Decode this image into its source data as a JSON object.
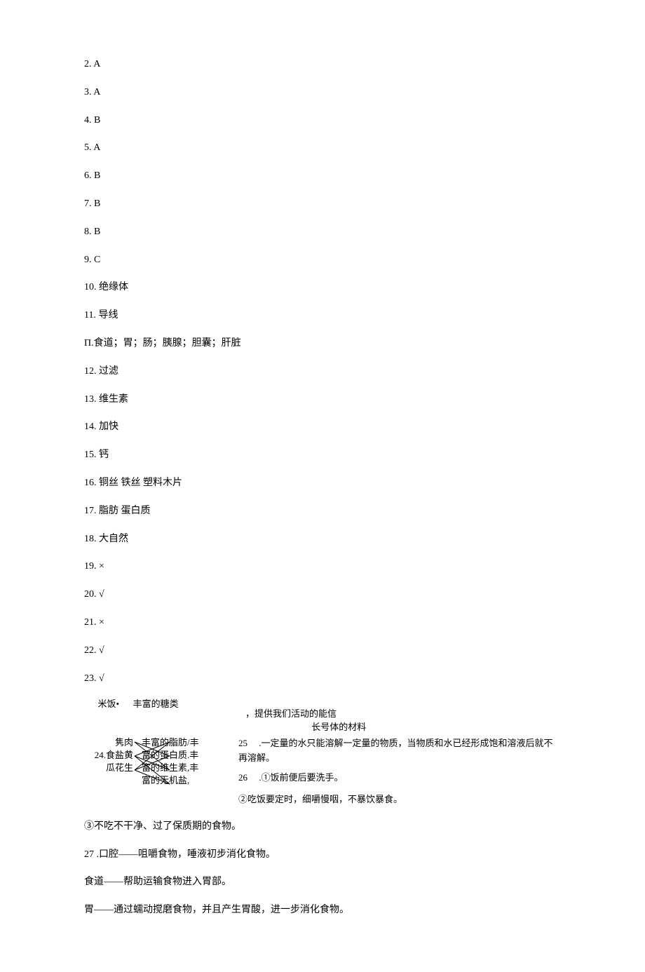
{
  "answers": [
    {
      "num": "2.",
      "val": "A"
    },
    {
      "num": "3.",
      "val": "A"
    },
    {
      "num": "4.",
      "val": "B"
    },
    {
      "num": "5.",
      "val": "A"
    },
    {
      "num": "6.",
      "val": "B"
    },
    {
      "num": "7.",
      "val": "B"
    },
    {
      "num": "8.",
      "val": "B"
    },
    {
      "num": "9.",
      "val": "C"
    },
    {
      "num": "10.",
      "val": "绝缘体"
    },
    {
      "num": "11.",
      "val": " 导线"
    }
  ],
  "rowPi": "Π.食道；胃；肠；胰腺；胆囊；肝脏",
  "answers2": [
    {
      "num": "12.",
      "val": " 过滤"
    },
    {
      "num": "13.",
      "val": " 维生素"
    },
    {
      "num": "14.",
      "val": " 加快"
    },
    {
      "num": "15.",
      "val": " 钙"
    },
    {
      "num": "16.",
      "val": " 铜丝 铁丝      塑料木片"
    },
    {
      "num": "17.",
      "val": " 脂肪 蛋白质"
    },
    {
      "num": "18.",
      "val": " 大自然"
    },
    {
      "num": "19.",
      "val": " ×"
    },
    {
      "num": "20.",
      "val": " √"
    },
    {
      "num": "21.",
      "val": " ×"
    },
    {
      "num": "22.",
      "val": " √"
    },
    {
      "num": "23.",
      "val": " √"
    }
  ],
  "match": {
    "topLeft1": "米饭•",
    "topLeft2": "丰富的糖类",
    "topLeft3": "，提供我们活动的能信",
    "topRight": "长号体的材料",
    "leftRows": [
      {
        "l": "隽肉",
        "r": "丰富的脂肪/丰"
      },
      {
        "l": "24.食盐黄",
        "r": "富的蛋白质.丰"
      },
      {
        "l": "瓜花生",
        "r": "富的维生素,丰"
      },
      {
        "l": "",
        "r": "富的无机盐,"
      }
    ],
    "q25num": "25",
    "q25text": " .一定量的水只能溶解一定量的物质，当物质和水已经形成饱和溶液后就不再溶解。",
    "q26num": "26",
    "q26text": " .①饭前便后要洗手。",
    "q26b": "②吃饭要定时，细嚼慢咽，不暴饮暴食。"
  },
  "tail": [
    "③不吃不干净、过了保质期的食物。",
    "27 .口腔——咀嚼食物，唾液初步消化食物。",
    "食道——帮助运输食物进入胃部。",
    "胃——通过蠕动搅磨食物，并且产生胃酸，进一步消化食物。"
  ]
}
